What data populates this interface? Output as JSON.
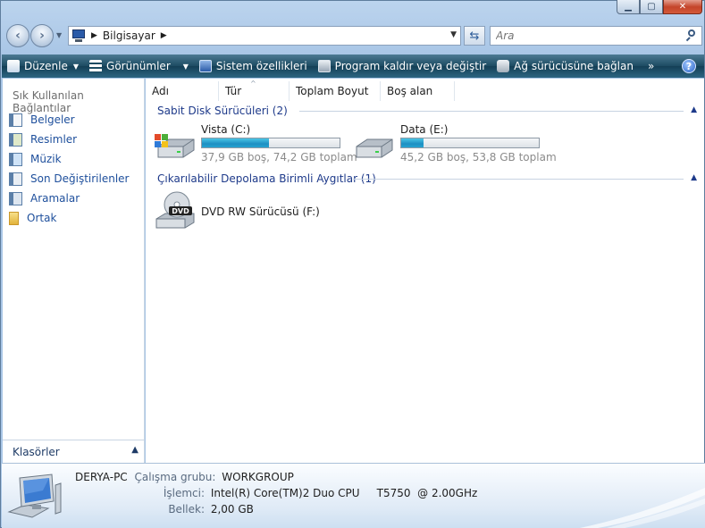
{
  "window": {
    "address_path": "Bilgisayar",
    "search_placeholder": "Ara",
    "help_label": "?"
  },
  "toolbar": {
    "items": [
      {
        "label": "Düzenle",
        "icon": "organize-icon",
        "dropdown": true
      },
      {
        "label": "Görünümler",
        "icon": "views-icon",
        "dropdown": true
      },
      {
        "label": "Sistem özellikleri",
        "icon": "system-properties-icon",
        "dropdown": false
      },
      {
        "label": "Program kaldır veya değiştir",
        "icon": "uninstall-icon",
        "dropdown": false
      },
      {
        "label": "Ağ sürücüsüne bağlan",
        "icon": "map-network-drive-icon",
        "dropdown": false
      }
    ],
    "more_label": "»"
  },
  "nav": {
    "heading": "Sık Kullanılan Bağlantılar",
    "items": [
      {
        "label": "Belgeler",
        "icon": "documents-icon"
      },
      {
        "label": "Resimler",
        "icon": "pictures-icon"
      },
      {
        "label": "Müzik",
        "icon": "music-icon"
      },
      {
        "label": "Son Değiştirilenler",
        "icon": "recent-icon"
      },
      {
        "label": "Aramalar",
        "icon": "searches-icon"
      },
      {
        "label": "Ortak",
        "icon": "public-folder-icon"
      }
    ],
    "folders_label": "Klasörler"
  },
  "columns": [
    "Adı",
    "Tür",
    "Toplam Boyut",
    "Boş alan"
  ],
  "groups": {
    "hdd": {
      "title": "Sabit Disk Sürücüleri (2)",
      "drives": [
        {
          "name": "Vista (C:)",
          "info": "37,9 GB boş, 74,2 GB toplam",
          "used_fraction": 0.489
        },
        {
          "name": "Data (E:)",
          "info": "45,2 GB boş, 53,8 GB toplam",
          "used_fraction": 0.16
        }
      ]
    },
    "removable": {
      "title": "Çıkarılabilir Depolama Birimli Aygıtlar (1)",
      "drives": [
        {
          "name": "DVD RW Sürücüsü (F:)",
          "icon_label": "DVD"
        }
      ]
    }
  },
  "details": {
    "computer_name": "DERYA-PC",
    "workgroup_label": "Çalışma grubu:",
    "workgroup": "WORKGROUP",
    "processor_label": "İşlemci:",
    "processor": "Intel(R) Core(TM)2 Duo CPU     T5750  @ 2.00GHz",
    "memory_label": "Bellek:",
    "memory": "2,00 GB"
  },
  "colors": {
    "toolbar_dark": "#1c4b62",
    "link_blue": "#1e4f9c",
    "group_blue": "#1e3a8a",
    "bar_fill": "#1e8fc2"
  }
}
